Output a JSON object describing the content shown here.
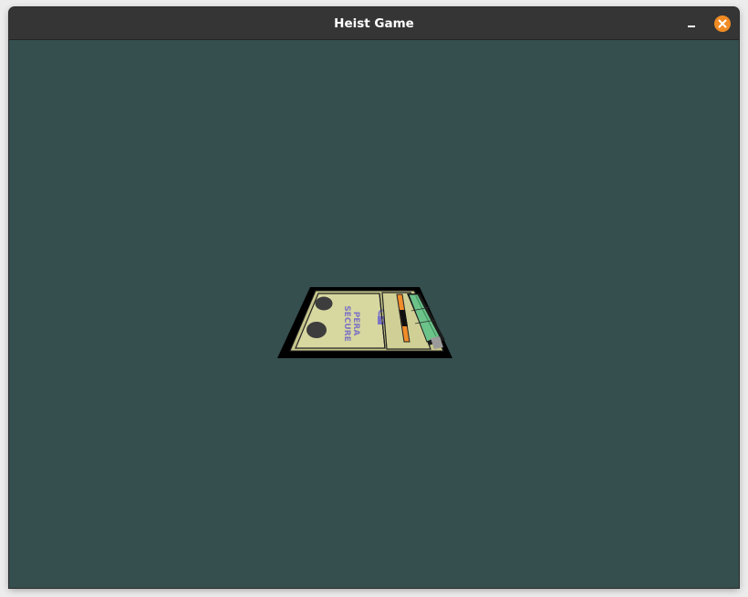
{
  "window": {
    "title": "Heist Game"
  },
  "titlebar": {
    "minimize_icon": "minimize-icon",
    "close_icon": "close-icon",
    "close_color": "#f18b23"
  },
  "scene": {
    "background_color": "#354e4e",
    "device": {
      "label_line1": "PERA",
      "label_line2": "SECURE"
    }
  }
}
